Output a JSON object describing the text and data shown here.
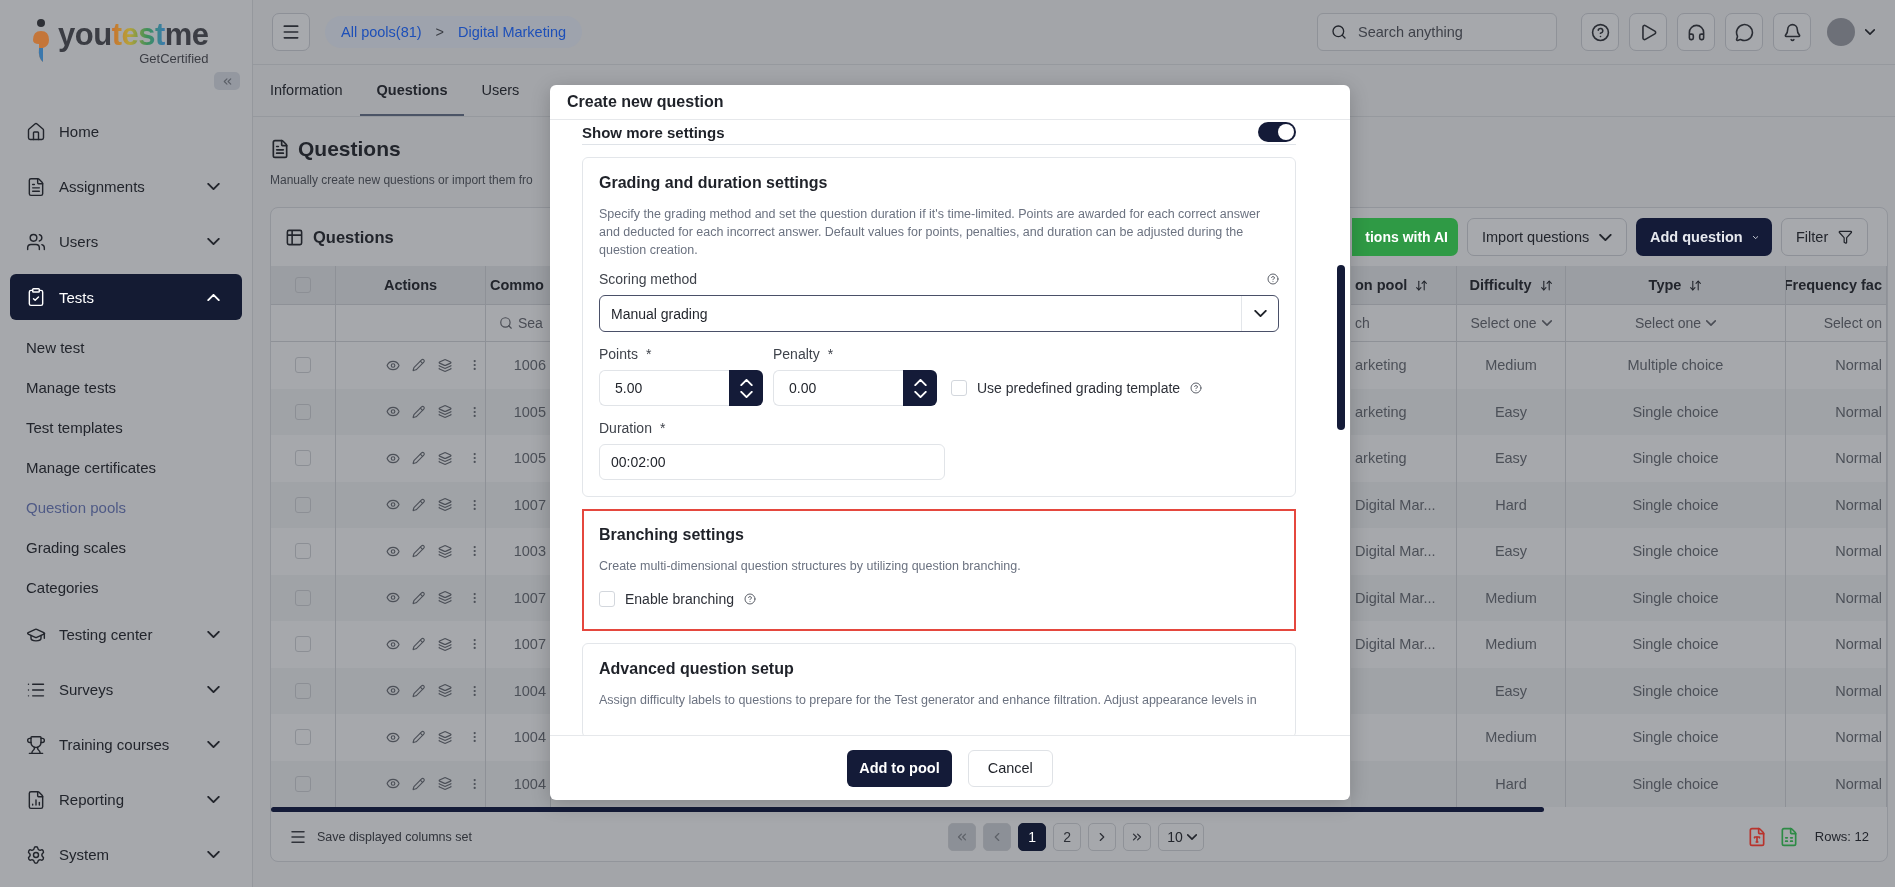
{
  "logo": {
    "parts": [
      "you",
      "test",
      "me"
    ],
    "tagline": "GetCertified"
  },
  "sidebar": {
    "items": [
      {
        "label": "Home",
        "expandable": false,
        "selected": false
      },
      {
        "label": "Assignments",
        "expandable": true,
        "expanded": false,
        "selected": false
      },
      {
        "label": "Users",
        "expandable": true,
        "expanded": false,
        "selected": false
      },
      {
        "label": "Tests",
        "expandable": true,
        "expanded": true,
        "selected": true,
        "children": [
          {
            "label": "New test",
            "selected": false
          },
          {
            "label": "Manage tests",
            "selected": false
          },
          {
            "label": "Test templates",
            "selected": false
          },
          {
            "label": "Manage certificates",
            "selected": false
          },
          {
            "label": "Question pools",
            "selected": true
          },
          {
            "label": "Grading scales",
            "selected": false
          },
          {
            "label": "Categories",
            "selected": false
          }
        ]
      },
      {
        "label": "Testing center",
        "expandable": true,
        "expanded": false,
        "selected": false
      },
      {
        "label": "Surveys",
        "expandable": true,
        "expanded": false,
        "selected": false
      },
      {
        "label": "Training courses",
        "expandable": true,
        "expanded": false,
        "selected": false
      },
      {
        "label": "Reporting",
        "expandable": true,
        "expanded": false,
        "selected": false
      },
      {
        "label": "System",
        "expandable": true,
        "expanded": false,
        "selected": false
      }
    ]
  },
  "topbar": {
    "breadcrumb": [
      "All pools(81)",
      "Digital Marketing"
    ],
    "separator": ">",
    "search": {
      "placeholder": "Search anything"
    }
  },
  "tabs": [
    {
      "label": "Information",
      "selected": false
    },
    {
      "label": "Questions",
      "selected": true
    },
    {
      "label": "Users",
      "selected": false
    }
  ],
  "page": {
    "title": "Questions",
    "subtitle": "Manually create new questions or import them fro"
  },
  "card": {
    "title": "Questions",
    "buttons": [
      {
        "label": "tions with AI",
        "kind": "ai"
      },
      {
        "label": "Import questions",
        "kind": "dropdown"
      },
      {
        "label": "Add question",
        "kind": "primary"
      },
      {
        "label": "Filter",
        "kind": "filter"
      }
    ],
    "select_all": {
      "checked": false
    },
    "left_columns": [
      {
        "label": "Actions"
      },
      {
        "label": "Commo",
        "filter": {
          "kind": "search",
          "placeholder": "Sea"
        }
      }
    ],
    "right_columns": [
      {
        "label": "on pool",
        "sortable": true,
        "filter": {
          "kind": "text",
          "text": "ch"
        }
      },
      {
        "label": "Difficulty",
        "sortable": true,
        "filter": {
          "kind": "select",
          "text": "Select one"
        }
      },
      {
        "label": "Type",
        "sortable": true,
        "filter": {
          "kind": "select",
          "text": "Select one"
        }
      },
      {
        "label": "Frequency fac",
        "sortable": false,
        "filter": {
          "kind": "text",
          "text": "Select on"
        }
      }
    ],
    "rows": [
      {
        "checked": false,
        "id": "1006",
        "pool": "arketing",
        "difficulty": "Medium",
        "type": "Multiple choice",
        "frequency": "Normal"
      },
      {
        "checked": false,
        "id": "1005",
        "pool": "arketing",
        "difficulty": "Easy",
        "type": "Single choice",
        "frequency": "Normal"
      },
      {
        "checked": false,
        "id": "1005",
        "pool": "arketing",
        "difficulty": "Easy",
        "type": "Single choice",
        "frequency": "Normal"
      },
      {
        "checked": false,
        "id": "1007",
        "pool": "Digital Mar...",
        "difficulty": "Hard",
        "type": "Single choice",
        "frequency": "Normal"
      },
      {
        "checked": false,
        "id": "1003",
        "pool": "Digital Mar...",
        "difficulty": "Easy",
        "type": "Single choice",
        "frequency": "Normal"
      },
      {
        "checked": false,
        "id": "1007",
        "pool": "Digital Mar...",
        "difficulty": "Medium",
        "type": "Single choice",
        "frequency": "Normal"
      },
      {
        "checked": false,
        "id": "1007",
        "pool": "Digital Mar...",
        "difficulty": "Medium",
        "type": "Single choice",
        "frequency": "Normal"
      },
      {
        "checked": false,
        "id": "1004",
        "difficulty": "Easy",
        "type": "Single choice",
        "frequency": "Normal"
      },
      {
        "checked": false,
        "id": "1004",
        "difficulty": "Medium",
        "type": "Single choice",
        "frequency": "Normal"
      },
      {
        "checked": false,
        "id": "1004",
        "difficulty": "Hard",
        "type": "Single choice",
        "frequency": "Normal"
      }
    ],
    "footer": {
      "save_columns": "Save displayed columns set",
      "nav": [
        {
          "kind": "first",
          "disabled": true
        },
        {
          "kind": "prev",
          "disabled": true
        }
      ],
      "pages": [
        {
          "label": "1",
          "selected": true
        },
        {
          "label": "2",
          "selected": false
        }
      ],
      "nav_after": [
        {
          "kind": "next",
          "disabled": false
        },
        {
          "kind": "last",
          "disabled": false
        }
      ],
      "page_size": "10",
      "rows": "Rows: 12"
    }
  },
  "modal": {
    "title": "Create new question",
    "show_more": {
      "label": "Show more settings",
      "on": true
    },
    "sections": [
      {
        "kind": "grading",
        "highlighted": false,
        "title": "Grading and duration settings",
        "description": "Specify the grading method and set the question duration if it's time-limited. Points are awarded for each correct answer and deducted for each incorrect answer. Default values for points, penalties, and duration can be adjusted during the question creation.",
        "scoring": {
          "label": "Scoring method",
          "value": "Manual grading"
        },
        "points": {
          "label": "Points",
          "mark": "*",
          "value": "5.00"
        },
        "penalty": {
          "label": "Penalty",
          "mark": "*",
          "value": "0.00"
        },
        "template": {
          "label": "Use predefined grading template",
          "checked": false
        },
        "duration": {
          "label": "Duration",
          "mark": "*",
          "value": "00:02:00"
        }
      },
      {
        "kind": "branching",
        "highlighted": true,
        "title": "Branching settings",
        "description": "Create multi-dimensional question structures by utilizing question branching.",
        "option": {
          "label": "Enable branching",
          "checked": false
        }
      },
      {
        "kind": "advanced",
        "highlighted": false,
        "title": "Advanced question setup",
        "description": "Assign difficulty labels to questions to prepare for the Test generator and enhance filtration. Adjust appearance levels in"
      }
    ],
    "buttons": [
      {
        "label": "Add to pool",
        "kind": "primary"
      },
      {
        "label": "Cancel",
        "kind": "secondary"
      }
    ]
  }
}
